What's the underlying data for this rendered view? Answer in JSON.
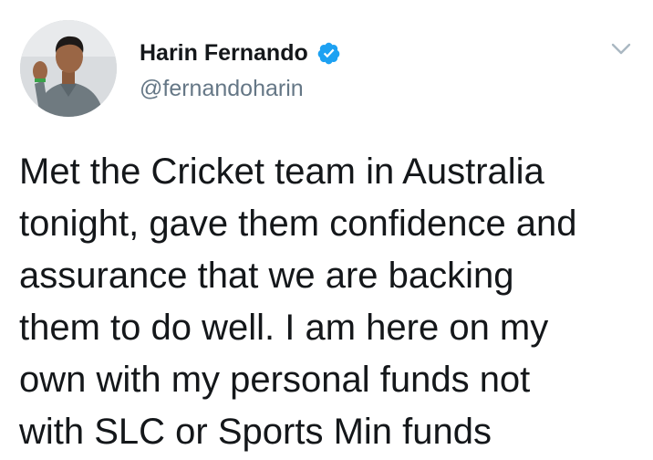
{
  "tweet": {
    "author": {
      "display_name": "Harin Fernando",
      "handle": "@fernandoharin",
      "verified": true,
      "verified_icon": "verified-badge-icon",
      "avatar": "profile-photo"
    },
    "menu_icon": "chevron-down-icon",
    "text_lines": [
      "Met the Cricket team in Australia",
      "tonight, gave them confidence and",
      "assurance that we are backing",
      "them to do well. I am here on my",
      "own with my personal funds not",
      "with SLC or Sports Min funds"
    ]
  },
  "colors": {
    "text": "#14171a",
    "secondary_text": "#657786",
    "verified_blue": "#1da1f2",
    "chevron": "#aab8c2",
    "background": "#ffffff"
  }
}
